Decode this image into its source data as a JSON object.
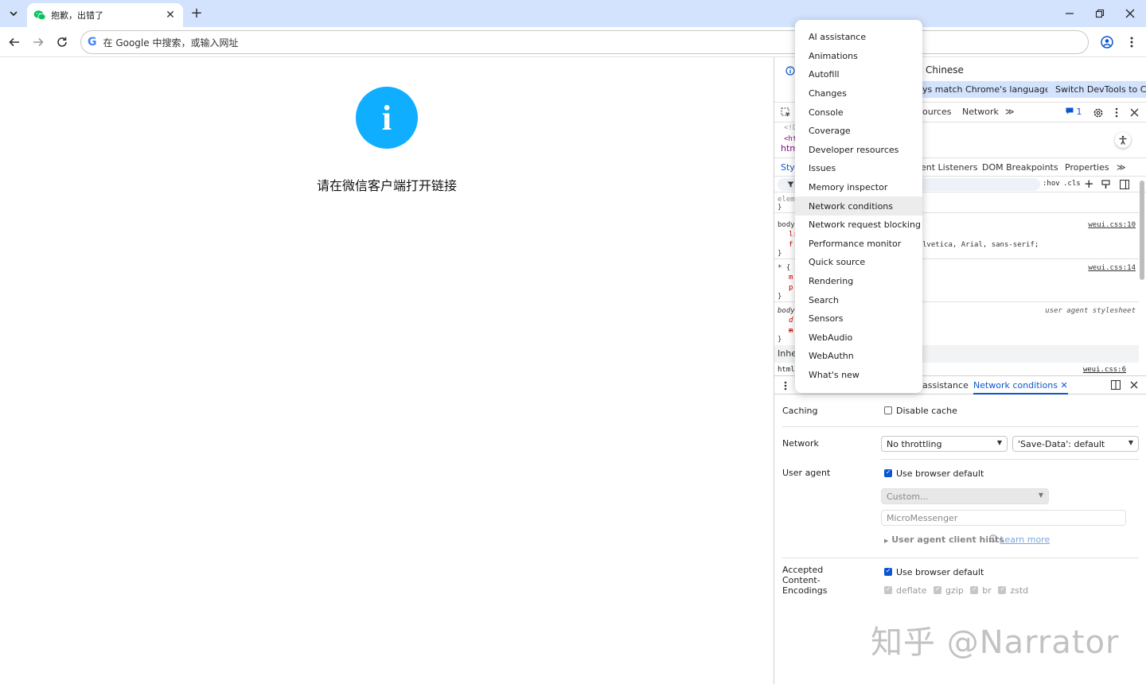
{
  "browser": {
    "tab": {
      "title": "抱歉，出错了",
      "close": "✕"
    },
    "new_tab": "+",
    "omnibox": {
      "placeholder": "在 Google 中搜索，或输入网址",
      "logo": "G"
    }
  },
  "page": {
    "message": "请在微信客户端打开链接",
    "info_glyph": "i",
    "accent_color": "#10aeff"
  },
  "devtools": {
    "language_banner": {
      "title": "Chinese",
      "match_button": "ys match Chrome's language",
      "switch_button": "Switch DevTools to Chin"
    },
    "main_tabs": [
      "ources",
      "Network",
      "≫"
    ],
    "issues_count": "1",
    "dom_lines": [
      "<!D",
      "<ht"
    ],
    "breadcrumb": "htm",
    "styles_tabs": [
      "Styl",
      "ent Listeners",
      "DOM Breakpoints",
      "Properties",
      "≫"
    ],
    "filter_buttons": [
      ":hov",
      ".cls",
      "+"
    ],
    "rules": [
      {
        "selector": "eleme",
        "source": ""
      },
      {
        "selector": "body",
        "source": "weui.css:10",
        "decl_lines": [
          "l:",
          "f"
        ],
        "decl": "lvetica, Arial, sans-serif;"
      },
      {
        "selector": "* {",
        "source": "weui.css:14",
        "decl_lines": [
          "m",
          "p"
        ]
      },
      {
        "selector": "body",
        "source": "user agent stylesheet",
        "decl_lines": [
          "d",
          "m"
        ]
      }
    ],
    "inherited_label": "Inhe",
    "html_rule": {
      "selector": "html",
      "source": "weui.css:6"
    },
    "drawer": {
      "tabs": [
        "assistance"
      ],
      "active_tab": "Network conditions",
      "active_tab_close": "✕"
    },
    "network_conditions": {
      "caching_label": "Caching",
      "disable_cache": "Disable cache",
      "network_label": "Network",
      "throttling": "No throttling",
      "save_data": "'Save-Data': default",
      "user_agent_label": "User agent",
      "use_browser_default": "Use browser default",
      "custom_placeholder": "Custom...",
      "ua_value": "MicroMessenger",
      "ua_client_hints": "User agent client hints",
      "learn_more": "Learn more",
      "encodings_label": "Accepted Content-Encodings",
      "encodings_default": "Use browser default",
      "encodings": [
        "deflate",
        "gzip",
        "br",
        "zstd"
      ]
    }
  },
  "more_tools_menu": {
    "items": [
      "AI assistance",
      "Animations",
      "Autofill",
      "Changes",
      "Console",
      "Coverage",
      "Developer resources",
      "Issues",
      "Memory inspector",
      "Network conditions",
      "Network request blocking",
      "Performance monitor",
      "Quick source",
      "Rendering",
      "Search",
      "Sensors",
      "WebAudio",
      "WebAuthn",
      "What's new"
    ],
    "highlighted": "Network conditions"
  },
  "watermark": "知乎 @Narrator"
}
